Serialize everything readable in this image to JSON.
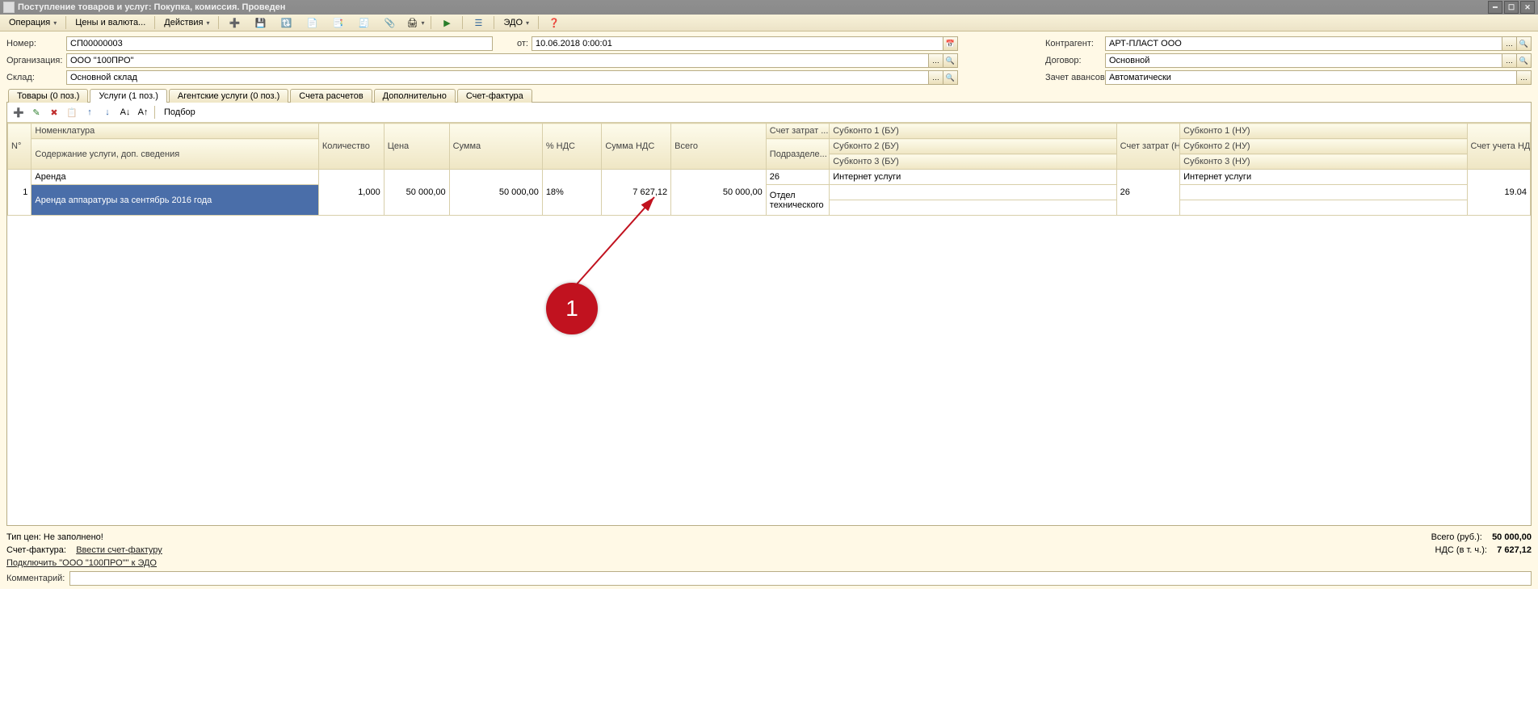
{
  "window": {
    "title": "Поступление товаров и услуг: Покупка, комиссия. Проведен"
  },
  "toolbar": {
    "menus": [
      "Операция",
      "Цены и валюта...",
      "Действия"
    ],
    "edo_label": "ЭДО"
  },
  "form": {
    "number_label": "Номер:",
    "number_value": "СП00000003",
    "from_label": "от:",
    "from_value": "10.06.2018 0:00:01",
    "org_label": "Организация:",
    "org_value": "ООО \"100ПРО\"",
    "warehouse_label": "Склад:",
    "warehouse_value": "Основной склад",
    "counter_label": "Контрагент:",
    "counter_value": "АРТ-ПЛАСТ ООО",
    "contract_label": "Договор:",
    "contract_value": "Основной",
    "advance_label": "Зачет авансов:",
    "advance_value": "Автоматически"
  },
  "tabs": [
    {
      "label": "Товары (0 поз.)"
    },
    {
      "label": "Услуги (1 поз.)"
    },
    {
      "label": "Агентские услуги (0 поз.)"
    },
    {
      "label": "Счета расчетов"
    },
    {
      "label": "Дополнительно"
    },
    {
      "label": "Счет-фактура"
    }
  ],
  "panel_toolbar": {
    "selection_label": "Подбор"
  },
  "grid": {
    "headers_row1": {
      "num": "N°",
      "nomenclature": "Номенклатура",
      "quantity": "Количество",
      "price": "Цена",
      "sum": "Сумма",
      "vat_percent": "% НДС",
      "vat_sum": "Сумма НДС",
      "total": "Всего",
      "cost_account": "Счет затрат ...",
      "subconto1_bu": "Субконто 1 (БУ)",
      "cost_account_nu": "Счет затрат (НУ)",
      "subconto1_nu": "Субконто 1 (НУ)",
      "vat_account": "Счет учета НДС"
    },
    "headers_row2": {
      "content": "Содержание услуги, доп. сведения",
      "subdivision": "Подразделе... затрат",
      "subconto2_bu": "Субконто 2 (БУ)",
      "subconto2_nu": "Субконто 2 (НУ)"
    },
    "headers_row3": {
      "subconto3_bu": "Субконто 3 (БУ)",
      "subconto3_nu": "Субконто 3 (НУ)"
    },
    "row": {
      "num": "1",
      "nomenclature": "Аренда",
      "content": "Аренда аппаратуры за сентябрь 2016 года",
      "quantity": "1,000",
      "price": "50 000,00",
      "sum": "50 000,00",
      "vat_percent": "18%",
      "vat_sum": "7 627,12",
      "total": "50 000,00",
      "cost_account": "26",
      "subdivision": "Отдел технического",
      "subconto1_bu": "Интернет услуги",
      "cost_account_nu": "26",
      "subconto1_nu": "Интернет услуги",
      "vat_account": "19.04"
    }
  },
  "footer": {
    "price_type": "Тип цен: Не заполнено!",
    "invoice_label": "Счет-фактура:",
    "invoice_link": "Ввести счет-фактуру",
    "edo_link": "Подключить \"ООО \"100ПРО\"\" к ЭДО",
    "comment_label": "Комментарий:",
    "total_label": "Всего (руб.):",
    "total_value": "50 000,00",
    "vat_label": "НДС (в т. ч.):",
    "vat_value": "7 627,12"
  },
  "annotation": {
    "number": "1"
  }
}
